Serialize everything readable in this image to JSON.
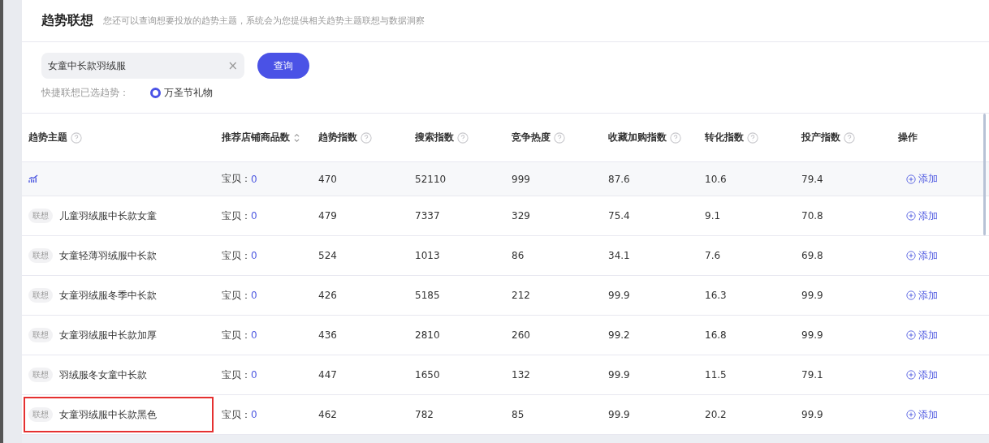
{
  "header": {
    "title": "趋势联想",
    "description": "您还可以查询想要投放的趋势主题，系统会为您提供相关趋势主题联想与数据洞察"
  },
  "search": {
    "value": "女童中长款羽绒服",
    "clear": "×",
    "button": "查询"
  },
  "quick": {
    "label": "快捷联想已选趋势：",
    "options": [
      {
        "label": "万圣节礼物",
        "selected": true
      }
    ]
  },
  "table": {
    "columns": [
      {
        "label": "趋势主题",
        "help": true,
        "sortable": false
      },
      {
        "label": "推荐店铺商品数",
        "help": false,
        "sortable": true
      },
      {
        "label": "趋势指数",
        "help": true,
        "sortable": false
      },
      {
        "label": "搜索指数",
        "help": true,
        "sortable": false
      },
      {
        "label": "竞争热度",
        "help": true,
        "sortable": false
      },
      {
        "label": "收藏加购指数",
        "help": true,
        "sortable": false
      },
      {
        "label": "转化指数",
        "help": true,
        "sortable": false
      },
      {
        "label": "投产指数",
        "help": true,
        "sortable": false
      },
      {
        "label": "操作",
        "help": false,
        "sortable": false
      }
    ],
    "rows": [
      {
        "kind": "trend",
        "items_label": "宝贝：",
        "items": "0",
        "values": [
          "470",
          "52110",
          "999",
          "87.6",
          "10.6",
          "79.4"
        ],
        "action": "添加",
        "highlighted": false
      },
      {
        "kind": "association",
        "tag": "联想",
        "name": "儿童羽绒服中长款女童",
        "items_label": "宝贝：",
        "items": "0",
        "values": [
          "479",
          "7337",
          "329",
          "75.4",
          "9.1",
          "70.8"
        ],
        "action": "添加",
        "highlighted": false
      },
      {
        "kind": "association",
        "tag": "联想",
        "name": "女童轻薄羽绒服中长款",
        "items_label": "宝贝：",
        "items": "0",
        "values": [
          "524",
          "1013",
          "86",
          "34.1",
          "7.6",
          "69.8"
        ],
        "action": "添加",
        "highlighted": false
      },
      {
        "kind": "association",
        "tag": "联想",
        "name": "女童羽绒服冬季中长款",
        "items_label": "宝贝：",
        "items": "0",
        "values": [
          "426",
          "5185",
          "212",
          "99.9",
          "16.3",
          "99.9"
        ],
        "action": "添加",
        "highlighted": false
      },
      {
        "kind": "association",
        "tag": "联想",
        "name": "女童羽绒服中长款加厚",
        "items_label": "宝贝：",
        "items": "0",
        "values": [
          "436",
          "2810",
          "260",
          "99.2",
          "16.8",
          "99.9"
        ],
        "action": "添加",
        "highlighted": false
      },
      {
        "kind": "association",
        "tag": "联想",
        "name": "羽绒服冬女童中长款",
        "items_label": "宝贝：",
        "items": "0",
        "values": [
          "447",
          "1650",
          "132",
          "99.9",
          "11.5",
          "79.1"
        ],
        "action": "添加",
        "highlighted": false
      },
      {
        "kind": "association",
        "tag": "联想",
        "name": "女童羽绒服中长款黑色",
        "items_label": "宝贝：",
        "items": "0",
        "values": [
          "462",
          "782",
          "85",
          "99.9",
          "20.2",
          "99.9"
        ],
        "action": "添加",
        "highlighted": true
      }
    ]
  }
}
